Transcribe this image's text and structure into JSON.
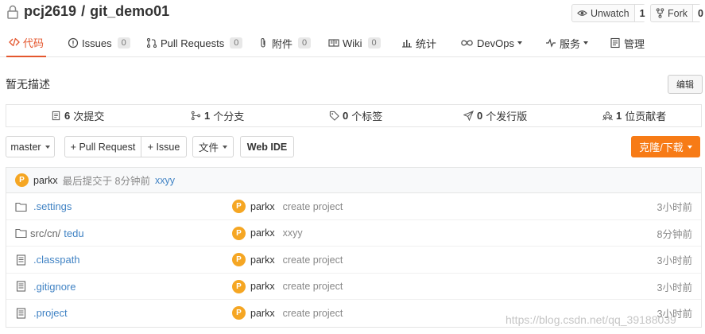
{
  "repo": {
    "owner": "pcj2619",
    "separator": "/",
    "name": "git_demo01"
  },
  "actions": {
    "watch_label": "Unwatch",
    "watch_count": "1",
    "fork_label": "Fork",
    "fork_count": "0"
  },
  "tabs": [
    {
      "label": "代码",
      "icon": "code-icon",
      "count": null
    },
    {
      "label": "Issues",
      "icon": "issue-icon",
      "count": "0"
    },
    {
      "label": "Pull Requests",
      "icon": "pull-request-icon",
      "count": "0"
    },
    {
      "label": "附件",
      "icon": "paperclip-icon",
      "count": "0"
    },
    {
      "label": "Wiki",
      "icon": "book-icon",
      "count": "0"
    },
    {
      "label": "统计",
      "icon": "chart-icon",
      "count": null
    },
    {
      "label": "DevOps",
      "icon": "infinity-icon",
      "count": null
    },
    {
      "label": "服务",
      "icon": "pulse-icon",
      "count": null
    },
    {
      "label": "管理",
      "icon": "settings-doc-icon",
      "count": null
    }
  ],
  "description": "暂无描述",
  "edit_label": "编辑",
  "stats": [
    {
      "num": "6",
      "label": "次提交"
    },
    {
      "num": "1",
      "label": "个分支"
    },
    {
      "num": "0",
      "label": "个标签"
    },
    {
      "num": "0",
      "label": "个发行版"
    },
    {
      "num": "1",
      "label": "位贡献者"
    }
  ],
  "toolbar": {
    "branch": "master",
    "pull_request": "+ Pull Request",
    "issue": "+ Issue",
    "files": "文件",
    "web_ide": "Web IDE",
    "clone": "克隆/下载"
  },
  "last_commit": {
    "avatar": "P",
    "author": "parkx",
    "text": "最后提交于 8分钟前",
    "message": "xxyy"
  },
  "files": [
    {
      "type": "folder",
      "prefix": "",
      "name": ".settings",
      "avatar": "P",
      "author": "parkx",
      "message": "create project",
      "time": "3小时前"
    },
    {
      "type": "folder",
      "prefix": "src/cn/",
      "name": "tedu",
      "avatar": "P",
      "author": "parkx",
      "message": "xxyy",
      "time": "8分钟前"
    },
    {
      "type": "file",
      "prefix": "",
      "name": ".classpath",
      "avatar": "P",
      "author": "parkx",
      "message": "create project",
      "time": "3小时前"
    },
    {
      "type": "file",
      "prefix": "",
      "name": ".gitignore",
      "avatar": "P",
      "author": "parkx",
      "message": "create project",
      "time": "3小时前"
    },
    {
      "type": "file",
      "prefix": "",
      "name": ".project",
      "avatar": "P",
      "author": "parkx",
      "message": "create project",
      "time": "3小时前"
    }
  ],
  "watermark": "https://blog.csdn.net/qq_39188039",
  "colors": {
    "accent": "#e4572e",
    "clone": "#f77b16",
    "link": "#4183c4",
    "avatar": "#f5a623"
  }
}
